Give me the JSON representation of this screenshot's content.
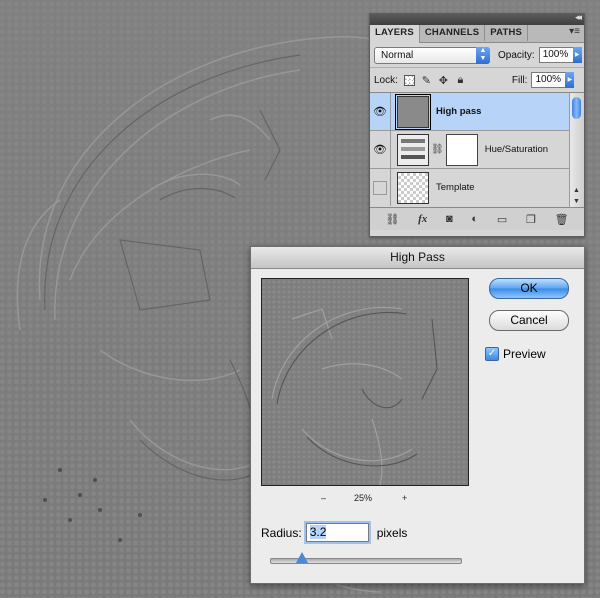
{
  "layers_panel": {
    "tabs": [
      "LAYERS",
      "CHANNELS",
      "PATHS"
    ],
    "active_tab": "LAYERS",
    "blend_mode": "Normal",
    "opacity_label": "Opacity:",
    "opacity_value": "100%",
    "lock_label": "Lock:",
    "fill_label": "Fill:",
    "fill_value": "100%",
    "layers": [
      {
        "name": "High pass",
        "visible": true,
        "selected": true
      },
      {
        "name": "Hue/Saturation",
        "visible": true,
        "selected": false
      },
      {
        "name": "Template",
        "visible": false,
        "selected": false
      }
    ],
    "bottom_icons": [
      "link-icon",
      "fx-icon",
      "mask-icon",
      "adjustment-icon",
      "group-icon",
      "new-layer-icon",
      "trash-icon"
    ],
    "fx_label": "fx"
  },
  "dialog": {
    "title": "High Pass",
    "ok_label": "OK",
    "cancel_label": "Cancel",
    "preview_label": "Preview",
    "preview_checked": true,
    "zoom_minus": "–",
    "zoom_value": "25%",
    "zoom_plus": "+",
    "radius_label": "Radius:",
    "radius_value": "3.2",
    "radius_unit": "pixels"
  },
  "colors": {
    "selection": "#b7d3f7",
    "accent_blue": "#3b8be6",
    "canvas_gray": "#7d7d7d"
  }
}
